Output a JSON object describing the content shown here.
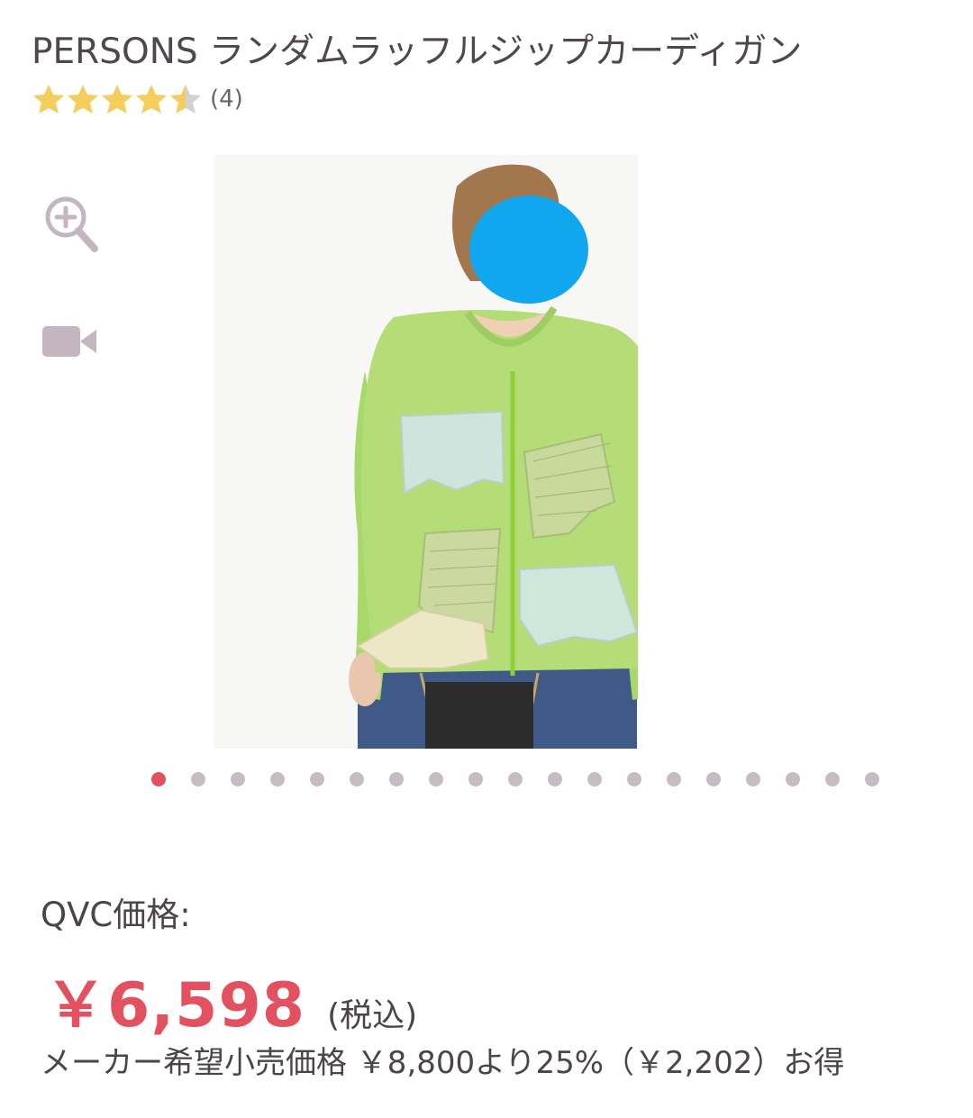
{
  "product": {
    "title": "PERSONS ランダムラッフルジップカーディガン",
    "rating_value": 4.5,
    "rating_max": 5,
    "review_count": "(4)"
  },
  "media_controls": {
    "zoom_icon": "zoom-in-icon",
    "video_icon": "video-camera-icon"
  },
  "gallery": {
    "total_images": 19,
    "active_index": 0
  },
  "pricing": {
    "label": "QVC価格:",
    "price": "￥6,598",
    "tax_note": "(税込)",
    "discount_text": "メーカー希望小売価格 ￥8,800より25%（￥2,202）お得"
  },
  "colors": {
    "accent": "#e3505f",
    "star": "#f5cd5c",
    "star_empty": "#cfd3d6",
    "icon": "#c4b6c0"
  }
}
